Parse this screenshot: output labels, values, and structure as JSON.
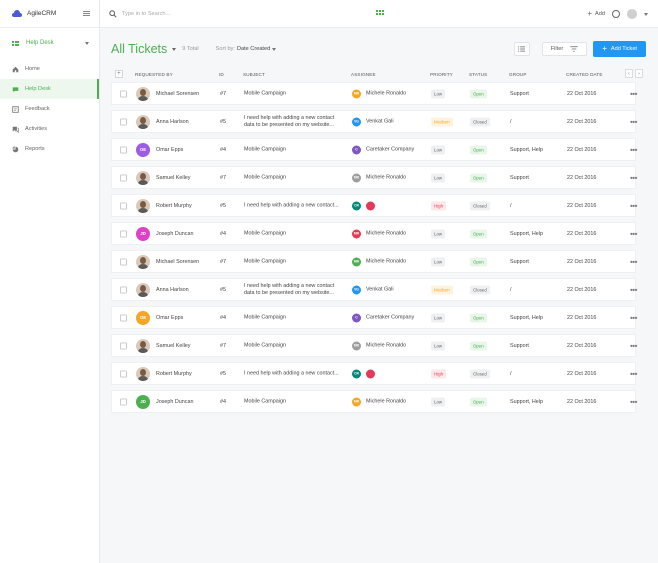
{
  "app": {
    "name": "AgileCRM"
  },
  "sidebar": {
    "module": "Help Desk",
    "items": [
      {
        "label": "Home",
        "icon": "home-icon"
      },
      {
        "label": "Help Desk",
        "icon": "helpdesk-icon",
        "active": true
      },
      {
        "label": "Feedback",
        "icon": "feedback-icon"
      },
      {
        "label": "Activities",
        "icon": "activities-icon"
      },
      {
        "label": "Reports",
        "icon": "reports-icon"
      }
    ]
  },
  "topbar": {
    "search_placeholder": "Type in to Search...",
    "add_label": "Add"
  },
  "page": {
    "title": "All Tickets",
    "total": "9 Total",
    "sort_prefix": "Sort by:",
    "sort_value": "Date Created",
    "filter_label": "Filter",
    "add_ticket_label": "Add Ticket"
  },
  "table": {
    "columns": [
      "Requested By",
      "ID",
      "Subject",
      "Assignee",
      "Priority",
      "Status",
      "Group",
      "Created Date"
    ],
    "rows": [
      {
        "name": "Michael Sorensen",
        "avatar": "photo",
        "id": "#7",
        "subject": "Mobile Campaign",
        "assignee": "Michele Ronaldo",
        "assignee_initials": "MR",
        "assignee_color": "#f5a623",
        "priority": "Low",
        "status": "Open",
        "group": "Support",
        "date": "22 Oct 2016"
      },
      {
        "name": "Anna Harlson",
        "avatar": "photo",
        "id": "#5",
        "subject": "I need help with adding a new contact data to be presented on my website...",
        "assignee": "Venkat Gali",
        "assignee_initials": "VG",
        "assignee_color": "#2196f3",
        "priority": "Medium",
        "status": "Closed",
        "group": "/",
        "date": "22 Oct 2016"
      },
      {
        "name": "Omar Epps",
        "avatar": "initials",
        "initials": "OE",
        "avatar_color": "#9c5ce6",
        "id": "#4",
        "subject": "Mobile Campaign",
        "assignee": "Caretaker Company",
        "assignee_initials": "C",
        "assignee_color": "#7e57c2",
        "priority": "Low",
        "status": "Open",
        "group": "Support, Help",
        "date": "22 Oct 2016"
      },
      {
        "name": "Samuel Kelley",
        "avatar": "photo",
        "id": "#7",
        "subject": "Mobile Campaign",
        "assignee": "Michele Ronaldo",
        "assignee_initials": "MR",
        "assignee_color": "#9e9e9e",
        "priority": "Low",
        "status": "Open",
        "group": "Support",
        "date": "22 Oct 2016"
      },
      {
        "name": "Robert Murphy",
        "avatar": "photo",
        "id": "#5",
        "subject": "I need help with adding a new contact...",
        "assignee": "",
        "assignee_initials": "CR",
        "assignee_color": "#00897b",
        "extra_assignee_color": "#e53955",
        "priority": "High",
        "status": "Closed",
        "group": "/",
        "date": "22 Oct 2016"
      },
      {
        "name": "Joseph Duncan",
        "avatar": "initials",
        "initials": "JD",
        "avatar_color": "#e040c8",
        "id": "#4",
        "subject": "Mobile Campaign",
        "assignee": "Michele Ronaldo",
        "assignee_initials": "MR",
        "assignee_color": "#e53955",
        "priority": "Low",
        "status": "Open",
        "group": "Support, Help",
        "date": "22 Oct 2016"
      },
      {
        "name": "Michael Sorensen",
        "avatar": "photo",
        "id": "#7",
        "subject": "Mobile Campaign",
        "assignee": "Michele Ronaldo",
        "assignee_initials": "MR",
        "assignee_color": "#4caf50",
        "priority": "Low",
        "status": "Open",
        "group": "Support",
        "date": "22 Oct 2016"
      },
      {
        "name": "Anna Harlson",
        "avatar": "photo",
        "id": "#5",
        "subject": "I need help with adding a new contact data to be presented on my website...",
        "assignee": "Venkat Gali",
        "assignee_initials": "VG",
        "assignee_color": "#2196f3",
        "priority": "Medium",
        "status": "Closed",
        "group": "/",
        "date": "22 Oct 2016"
      },
      {
        "name": "Omar Epps",
        "avatar": "initials",
        "initials": "OE",
        "avatar_color": "#f5a623",
        "id": "#4",
        "subject": "Mobile Campaign",
        "assignee": "Caretaker Company",
        "assignee_initials": "C",
        "assignee_color": "#7e57c2",
        "priority": "Low",
        "status": "Open",
        "group": "Support, Help",
        "date": "22 Oct 2016"
      },
      {
        "name": "Samuel Kelley",
        "avatar": "photo",
        "id": "#7",
        "subject": "Mobile Campaign",
        "assignee": "Michele Ronaldo",
        "assignee_initials": "MR",
        "assignee_color": "#9e9e9e",
        "priority": "Low",
        "status": "Open",
        "group": "Support",
        "date": "22 Oct 2016"
      },
      {
        "name": "Robert Murphy",
        "avatar": "photo",
        "id": "#5",
        "subject": "I need help with adding a new contact...",
        "assignee": "",
        "assignee_initials": "CR",
        "assignee_color": "#00897b",
        "extra_assignee_color": "#e53955",
        "priority": "High",
        "status": "Closed",
        "group": "/",
        "date": "22 Oct 2016"
      },
      {
        "name": "Joseph Duncan",
        "avatar": "initials",
        "initials": "JD",
        "avatar_color": "#4caf50",
        "id": "#4",
        "subject": "Mobile Campaign",
        "assignee": "Michele Ronaldo",
        "assignee_initials": "MR",
        "assignee_color": "#f5a623",
        "priority": "Low",
        "status": "Open",
        "group": "Support, Help",
        "date": "22 Oct 2016"
      }
    ]
  },
  "colors": {
    "brand": "#4c5bd4",
    "accent": "#4caf50",
    "primary_button": "#2196f3"
  }
}
